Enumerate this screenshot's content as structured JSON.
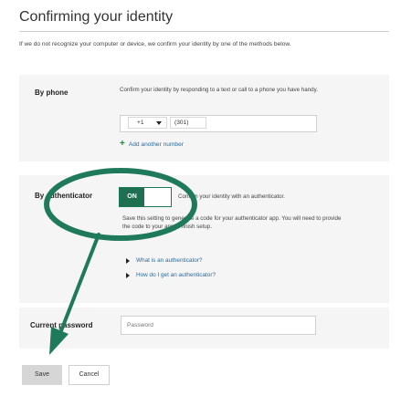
{
  "page": {
    "title": "Confirming your identity",
    "intro": "If we do not recognize your computer or device, we confirm your identity by one of the methods below."
  },
  "phone": {
    "label": "By phone",
    "description": "Confirm your identity by responding to a text or call to a phone you have handy.",
    "country_code": "+1",
    "number": "(301)",
    "add_link": "Add another number"
  },
  "authenticator": {
    "label": "By authenticator",
    "toggle": "ON",
    "description": "Confirm your identity with an authenticator.",
    "setup_note": "Save this setting to generate a code for your authenticator app. You will need to provide the code to your app to finish setup.",
    "links": [
      "What is an authenticator?",
      "How do I get an authenticator?"
    ]
  },
  "password": {
    "label": "Current password",
    "placeholder": "Password"
  },
  "actions": {
    "save": "Save",
    "cancel": "Cancel"
  },
  "colors": {
    "annotation": "#1f7a5c",
    "toggle_on": "#1f6f52",
    "link": "#2a6a9e"
  }
}
